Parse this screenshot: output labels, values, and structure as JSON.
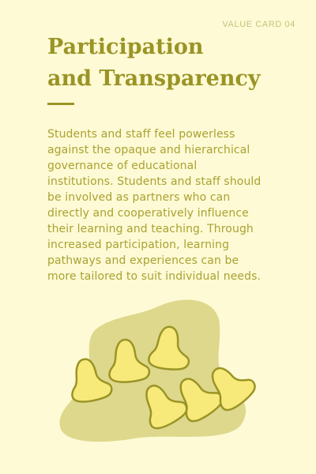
{
  "card": {
    "label": "VALUE CARD 04",
    "title_lines": [
      "Participation",
      "and Transparency"
    ],
    "body_lines": [
      "Students and staff feel powerless",
      "against the opaque and hierarchical",
      "governance of educational",
      "institutions. Students and staff should",
      "be involved as partners who can",
      "directly and cooperatively influence",
      "their learning and teaching. Through",
      "increased participation, learning",
      "pathways and experiences can be",
      "more tailored to suit individual needs."
    ]
  },
  "colors": {
    "background": "#fefad5",
    "accent": "#9a9426",
    "label": "#c7c27e",
    "body_text": "#a9a232",
    "blob": "#ddd88c",
    "figure_fill": "#f7e97a",
    "figure_stroke": "#9a9426"
  },
  "illustration": {
    "icon": "group-of-figures-icon",
    "figure_count": 6
  }
}
